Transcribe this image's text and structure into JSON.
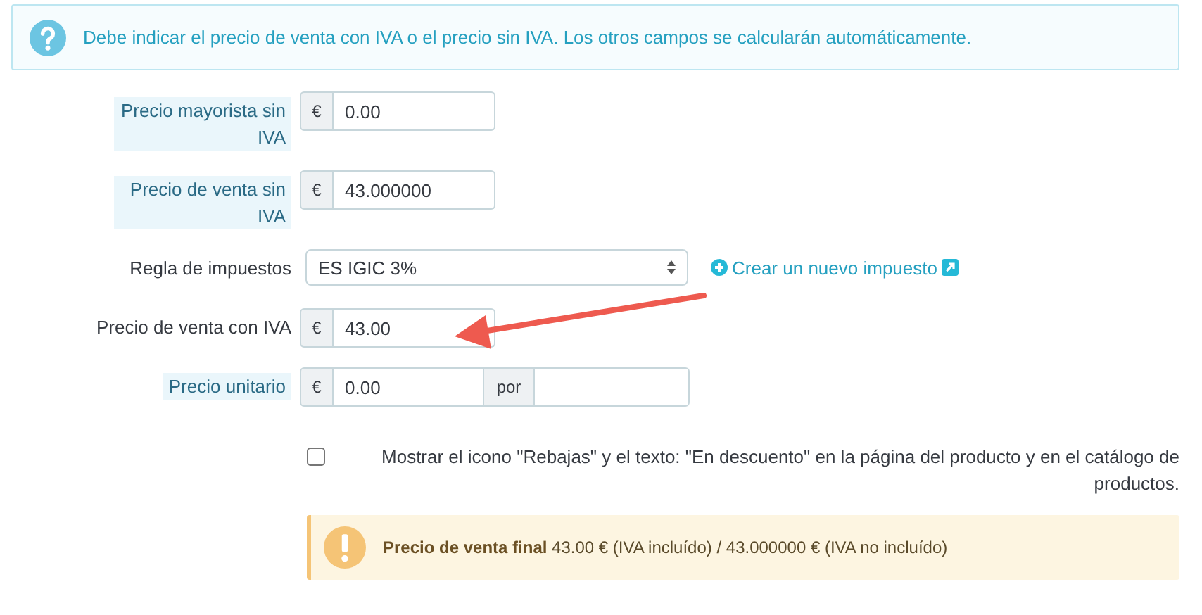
{
  "info_alert": {
    "text": "Debe indicar el precio de venta con IVA o el precio sin IVA. Los otros campos se calcularán automáticamente."
  },
  "fields": [
    {
      "kind": "price",
      "label": "Precio mayorista sin IVA",
      "help": true,
      "currency": "€",
      "value": "0.00"
    },
    {
      "kind": "price",
      "label": "Precio de venta sin IVA",
      "help": true,
      "currency": "€",
      "value": "43.000000"
    },
    {
      "kind": "select",
      "label": "Regla de impuestos",
      "help": false,
      "value": "ES IGIC 3%",
      "link": "Crear un nuevo impuesto"
    },
    {
      "kind": "price",
      "label": "Precio de venta con IVA",
      "help": false,
      "currency": "€",
      "value": "43.00"
    },
    {
      "kind": "unit",
      "label": "Precio unitario",
      "help": true,
      "currency": "€",
      "value": "0.00",
      "unit_label": "por"
    }
  ],
  "on_sale": {
    "checked": false,
    "label": "Mostrar el icono \"Rebajas\" y el texto: \"En descuento\" en la página del producto y en el catálogo de productos."
  },
  "final_price": {
    "text": "**Precio de venta final** 43.00 € (IVA incluído) / 43.000000 € (IVA no incluído)"
  }
}
